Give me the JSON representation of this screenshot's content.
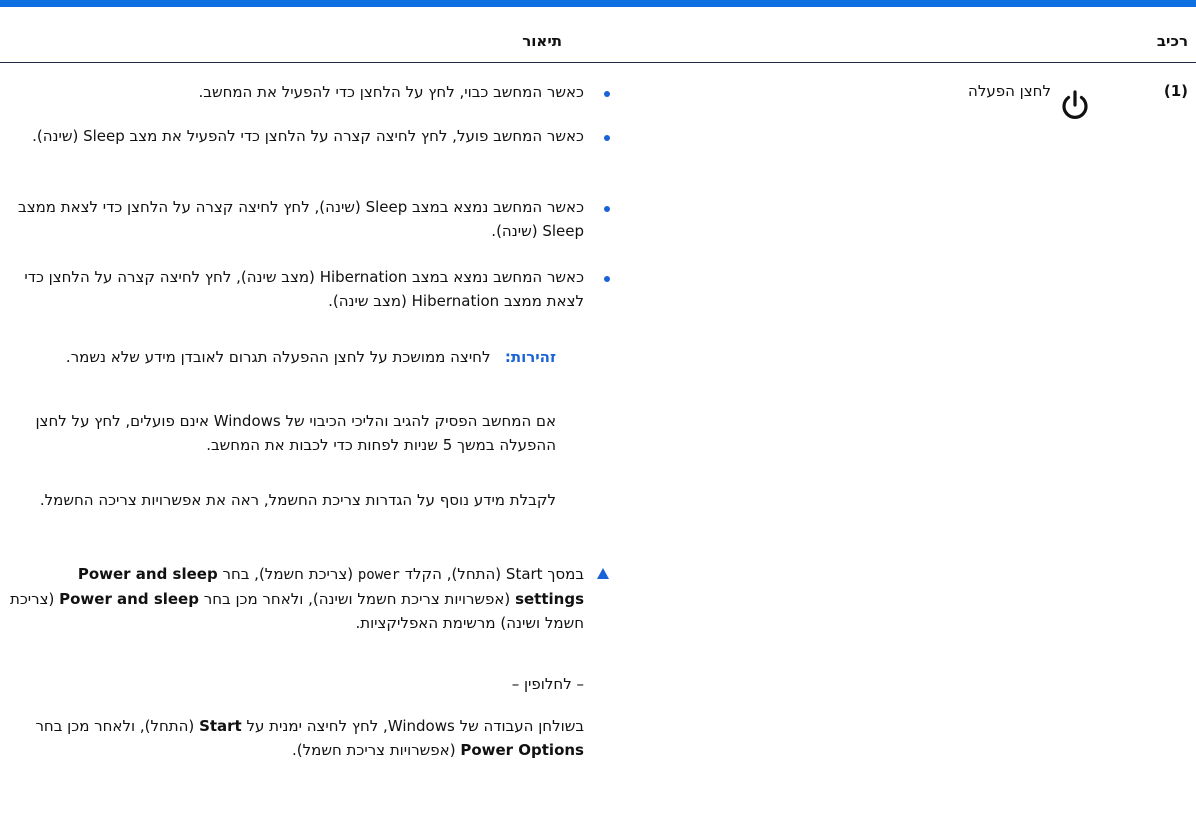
{
  "table": {
    "header_component": "רכיב",
    "header_description": "תיאור"
  },
  "row": {
    "number": "(1)",
    "icon": "power-icon",
    "name": "לחצן הפעלה"
  },
  "bullets": [
    "כאשר המחשב כבוי, לחץ על הלחצן כדי להפעיל את המחשב.",
    "כאשר המחשב פועל, לחץ לחיצה קצרה על הלחצן כדי להפעיל את מצב Sleep (שינה).",
    "כאשר המחשב נמצא במצב Sleep (שינה), לחץ לחיצה קצרה על הלחצן כדי לצאת ממצב Sleep (שינה).",
    "כאשר המחשב נמצא במצב Hibernation (מצב שינה), לחץ לחיצה קצרה על הלחצן כדי לצאת ממצב Hibernation (מצב שינה)."
  ],
  "caution": {
    "label": "זהירות:",
    "text": "לחיצה ממושכת על לחצן ההפעלה תגרום לאובדן מידע שלא נשמר."
  },
  "para_shutdown": "אם המחשב הפסיק להגיב והליכי הכיבוי של Windows אינם פועלים, לחץ על לחצן ההפעלה במשך 5 שניות לפחות כדי לכבות את המחשב.",
  "para_more_info": "לקבלת מידע נוסף על הגדרות צריכת החשמל, ראה את אפשרויות צריכה החשמל.",
  "step": {
    "part1": "במסך Start (התחל), הקלד ",
    "code": "power",
    "part2": " (צריכת חשמל), בחר ",
    "bold1": "Power and sleep settings",
    "part3": " (אפשרויות צריכת חשמל ושינה), ולאחר מכן בחר ",
    "bold2": "Power and sleep",
    "part4": " (צריכת חשמל ושינה) מרשימת האפליקציות."
  },
  "alternative": "– לחלופין –",
  "step2": {
    "part1": "בשולחן העבודה של Windows, לחץ לחיצה ימנית על ",
    "bold1": "Start",
    "part2": " (התחל), ולאחר מכן בחר ",
    "bold2": "Power Options",
    "part3": " (אפשרויות צריכת חשמל)."
  },
  "colors": {
    "accent": "#1a63d6",
    "top_bar": "#0d6fe0"
  }
}
